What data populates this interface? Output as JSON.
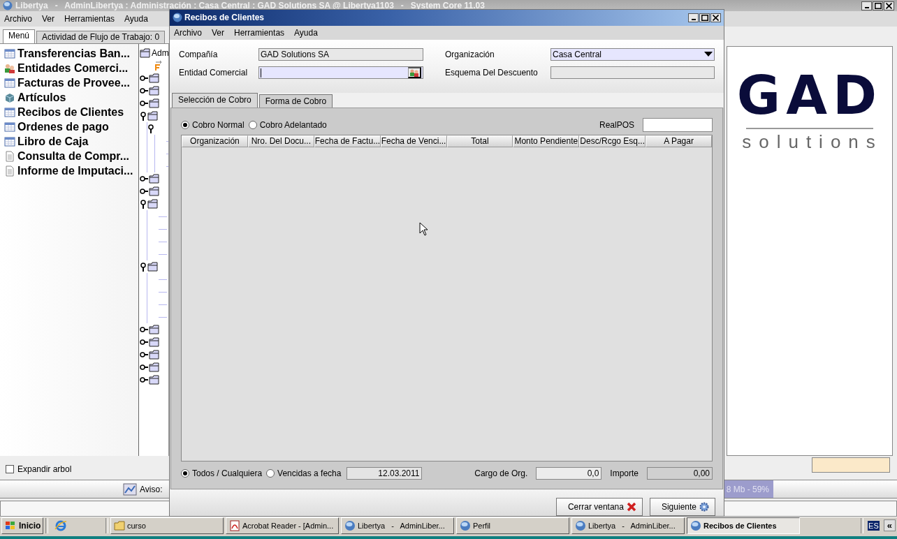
{
  "main_window": {
    "title": "Libertya   -   AdminLibertya : Administración : Casa Central : GAD Solutions SA @ Libertya1103   -   System Core 11.03",
    "menu": [
      "Archivo",
      "Ver",
      "Herramientas",
      "Ayuda"
    ],
    "tabs": [
      {
        "label": "Menú",
        "selected": true
      },
      {
        "label": "Actividad de Flujo de Trabajo: 0",
        "selected": false
      }
    ],
    "menu_items": [
      {
        "label": "Transferencias Ban...",
        "kind": "window"
      },
      {
        "label": "Entidades Comerci...",
        "kind": "people"
      },
      {
        "label": "Facturas de Provee...",
        "kind": "window"
      },
      {
        "label": "Artículos",
        "kind": "cube"
      },
      {
        "label": "Recibos de Clientes",
        "kind": "window"
      },
      {
        "label": "Ordenes de pago",
        "kind": "window"
      },
      {
        "label": "Libro de Caja",
        "kind": "window"
      },
      {
        "label": "Consulta de Compr...",
        "kind": "document"
      },
      {
        "label": "Informe de Imputaci...",
        "kind": "document"
      }
    ],
    "tree": {
      "root": "Adm",
      "nodes": [
        {
          "kind": "process"
        },
        {
          "kind": "folder",
          "expanded": false
        },
        {
          "kind": "folder",
          "expanded": false
        },
        {
          "kind": "folder",
          "expanded": false
        },
        {
          "kind": "folder",
          "expanded": true,
          "children": [
            {
              "kind": "node",
              "expanded": true,
              "children": [
                {
                  "kind": "hidden"
                },
                {
                  "kind": "hidden"
                },
                {
                  "kind": "hidden"
                }
              ]
            }
          ]
        },
        {
          "kind": "folder",
          "expanded": false
        },
        {
          "kind": "folder",
          "expanded": false
        },
        {
          "kind": "folder",
          "expanded": true,
          "children": [
            {
              "kind": "hidden"
            },
            {
              "kind": "hidden"
            },
            {
              "kind": "hidden"
            },
            {
              "kind": "hidden"
            }
          ]
        },
        {
          "kind": "folder",
          "expanded": true,
          "children": [
            {
              "kind": "hidden"
            },
            {
              "kind": "hidden"
            },
            {
              "kind": "hidden"
            },
            {
              "kind": "hidden"
            }
          ]
        },
        {
          "kind": "folder",
          "expanded": false
        },
        {
          "kind": "folder",
          "expanded": false
        },
        {
          "kind": "folder",
          "expanded": false
        },
        {
          "kind": "folder",
          "expanded": false
        },
        {
          "kind": "folder",
          "expanded": false
        }
      ]
    },
    "expand_tree": {
      "label": "Expandir arbol",
      "checked": false
    },
    "notice": "Aviso:",
    "memory": "8 Mb - 59%",
    "logo": {
      "name": "GAD",
      "tagline": "solutions"
    }
  },
  "dialog": {
    "title": "Recibos de Clientes",
    "menu": [
      "Archivo",
      "Ver",
      "Herramientas",
      "Ayuda"
    ],
    "fields": [
      {
        "label": "Compañía",
        "value": "GAD Solutions SA",
        "kind": "text",
        "disabled": true
      },
      {
        "label": "Organización",
        "value": "Casa Central",
        "kind": "select",
        "disabled": false
      },
      {
        "label": "Entidad Comercial",
        "kind": "search",
        "disabled": false
      },
      {
        "label": "Esquema Del Descuento",
        "kind": "text",
        "disabled": true
      }
    ],
    "tabs": [
      {
        "label": "Selección de Cobro",
        "selected": true
      },
      {
        "label": "Forma de Cobro",
        "selected": false
      }
    ],
    "payment_types": [
      {
        "label": "Cobro Normal",
        "selected": true
      },
      {
        "label": "Cobro Adelantado",
        "selected": false
      }
    ],
    "realpos": {
      "label": "RealPOS"
    },
    "table": {
      "columns": [
        "Organización",
        "Nro. Del Docu...",
        "Fecha de Factu...",
        "Fecha de Venci...",
        "Total",
        "Monto Pendiente",
        "Desc/Rcgo Esq...",
        "A Pagar"
      ]
    },
    "filters": [
      {
        "label": "Todos / Cualquiera",
        "selected": true
      },
      {
        "label": "Vencidas a fecha",
        "selected": false
      }
    ],
    "due_date": "12.03.2011",
    "org_charge": {
      "label": "Cargo de Org.",
      "value": "0,0"
    },
    "amount": {
      "label": "Importe",
      "value": "0,00"
    },
    "buttons": [
      {
        "label": "Cerrar ventana",
        "kind": "close"
      },
      {
        "label": "Siguiente",
        "kind": "next"
      }
    ]
  },
  "taskbar": {
    "start": "Inicio",
    "items": [
      {
        "label": "curso",
        "kind": "folder",
        "selected": false
      },
      {
        "label": "Acrobat Reader - [Admin...",
        "kind": "pdf",
        "selected": false
      },
      {
        "label": "Libertya   -   AdminLiber...",
        "kind": "app",
        "selected": false
      },
      {
        "label": "Perfil",
        "kind": "app",
        "selected": false
      },
      {
        "label": "Libertya   -   AdminLiber...",
        "kind": "app",
        "selected": false
      },
      {
        "label": "Recibos de Clientes",
        "kind": "app",
        "selected": true
      }
    ],
    "language": "ES",
    "expand": "«"
  }
}
